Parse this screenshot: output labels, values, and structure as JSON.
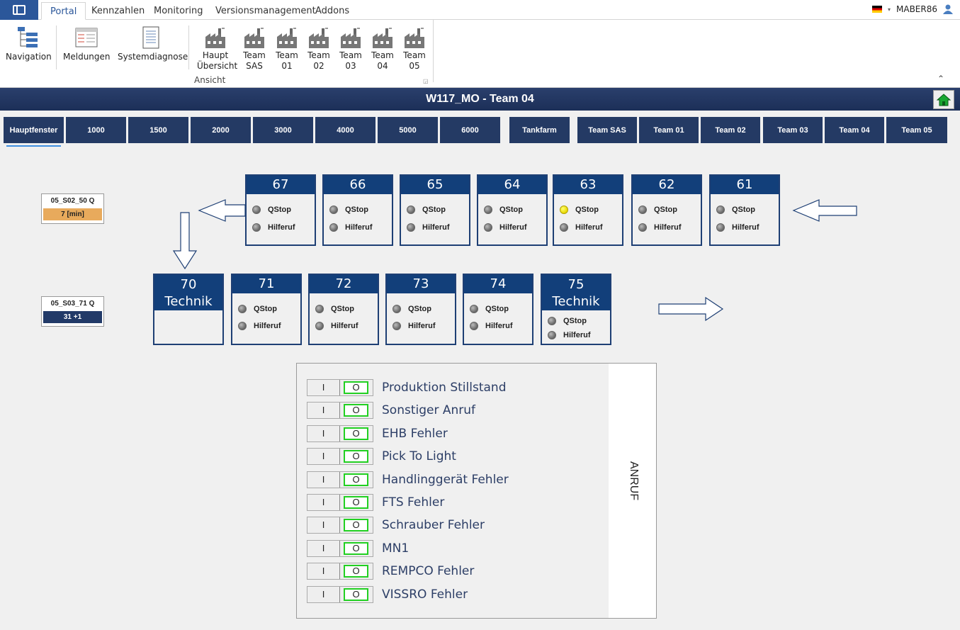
{
  "ribbon": {
    "tabs": [
      "Portal",
      "Kennzahlen",
      "Monitoring",
      "Versionsmanagement",
      "Addons"
    ],
    "user": "MABER86",
    "buttons": {
      "navigation": "Navigation",
      "meldungen": "Meldungen",
      "systemdiagnose": "Systemdiagnose",
      "haupt_l1": "Haupt",
      "haupt_l2": "Übersicht",
      "team_sas_l1": "Team",
      "team_sas_l2": "SAS",
      "team01_l1": "Team",
      "team01_l2": "01",
      "team02_l1": "Team",
      "team02_l2": "02",
      "team03_l1": "Team",
      "team03_l2": "03",
      "team04_l1": "Team",
      "team04_l2": "04",
      "team05_l1": "Team",
      "team05_l2": "05"
    },
    "group_label": "Ansicht"
  },
  "title": "W117_MO - Team 04",
  "nav": [
    "Hauptfenster",
    "1000",
    "1500",
    "2000",
    "3000",
    "4000",
    "5000",
    "6000",
    "Tankfarm",
    "Team SAS",
    "Team 01",
    "Team 02",
    "Team 03",
    "Team 04",
    "Team 05"
  ],
  "info1": {
    "title": "05_S02_50 Q",
    "value": "7 [min]"
  },
  "info2": {
    "title": "05_S03_71 Q",
    "value": "31 +1"
  },
  "lamp_labels": {
    "qstop": "QStop",
    "hilferuf": "Hilferuf"
  },
  "stations_top": [
    {
      "num": "67",
      "qstop_on": false
    },
    {
      "num": "66",
      "qstop_on": false
    },
    {
      "num": "65",
      "qstop_on": false
    },
    {
      "num": "64",
      "qstop_on": false
    },
    {
      "num": "63",
      "qstop_on": true
    },
    {
      "num": "62",
      "qstop_on": false
    },
    {
      "num": "61",
      "qstop_on": false
    }
  ],
  "stations_bottom": [
    {
      "num": "70",
      "sub": "Technik"
    },
    {
      "num": "71"
    },
    {
      "num": "72"
    },
    {
      "num": "73"
    },
    {
      "num": "74"
    },
    {
      "num": "75",
      "sub": "Technik"
    }
  ],
  "panel": {
    "side_label": "ANRUF",
    "switch_on": "I",
    "switch_off": "O",
    "rows": [
      "Produktion Stillstand",
      "Sonstiger Anruf",
      "EHB Fehler",
      "Pick To Light",
      "Handlinggerät Fehler",
      "FTS Fehler",
      "Schrauber Fehler",
      "MN1",
      "REMPCO Fehler",
      "VISSRO Fehler"
    ]
  },
  "colors": {
    "accent": "#2b579a",
    "station_header": "#123f7a",
    "nav": "#243a64",
    "lamp_on": "#ffff40",
    "switch_green": "#22d022"
  }
}
